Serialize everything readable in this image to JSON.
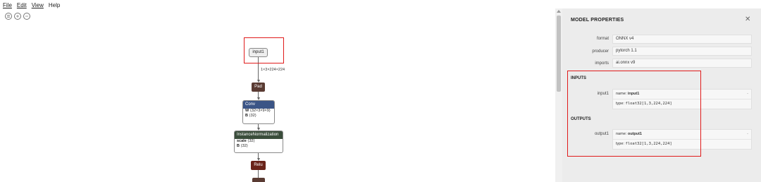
{
  "menu": {
    "file": "File",
    "edit": "Edit",
    "view": "View",
    "help": "Help"
  },
  "toolbar": {
    "icons": [
      "menu-icon",
      "zoom-in-icon",
      "zoom-out-icon"
    ]
  },
  "graph": {
    "input_node": "input1",
    "edge_shape": "1×3×224×224",
    "pad_label": "Pad",
    "conv": {
      "title": "Conv",
      "w_key": "W",
      "w_val": "⟨32×3×9×9⟩",
      "b_key": "B",
      "b_val": "⟨32⟩"
    },
    "inorm": {
      "title": "InstanceNormalization",
      "scale_key": "scale",
      "scale_val": "⟨32⟩",
      "b_key": "B",
      "b_val": "⟨32⟩"
    },
    "relu_label": "Relu",
    "colors": {
      "pad": "#5a3b33",
      "conv": "#3b5586",
      "inorm": "#3a4d3b",
      "relu": "#6a2319",
      "highlight": "#e01b1b"
    }
  },
  "sidebar": {
    "title": "MODEL PROPERTIES",
    "close": "✕",
    "props": [
      {
        "label": "format",
        "value": "ONNX v4"
      },
      {
        "label": "producer",
        "value": "pytorch 1.1"
      },
      {
        "label": "imports",
        "value": "ai.onnx v9"
      }
    ],
    "inputs_heading": "INPUTS",
    "input": {
      "label": "input1",
      "name_key": "name:",
      "name": "input1",
      "type_key": "type:",
      "type": "float32[1,3,224,224]",
      "expand": "-"
    },
    "outputs_heading": "OUTPUTS",
    "output": {
      "label": "output1",
      "name_key": "name:",
      "name": "output1",
      "type_key": "type:",
      "type": "float32[1,3,224,224]",
      "expand": "-"
    }
  }
}
